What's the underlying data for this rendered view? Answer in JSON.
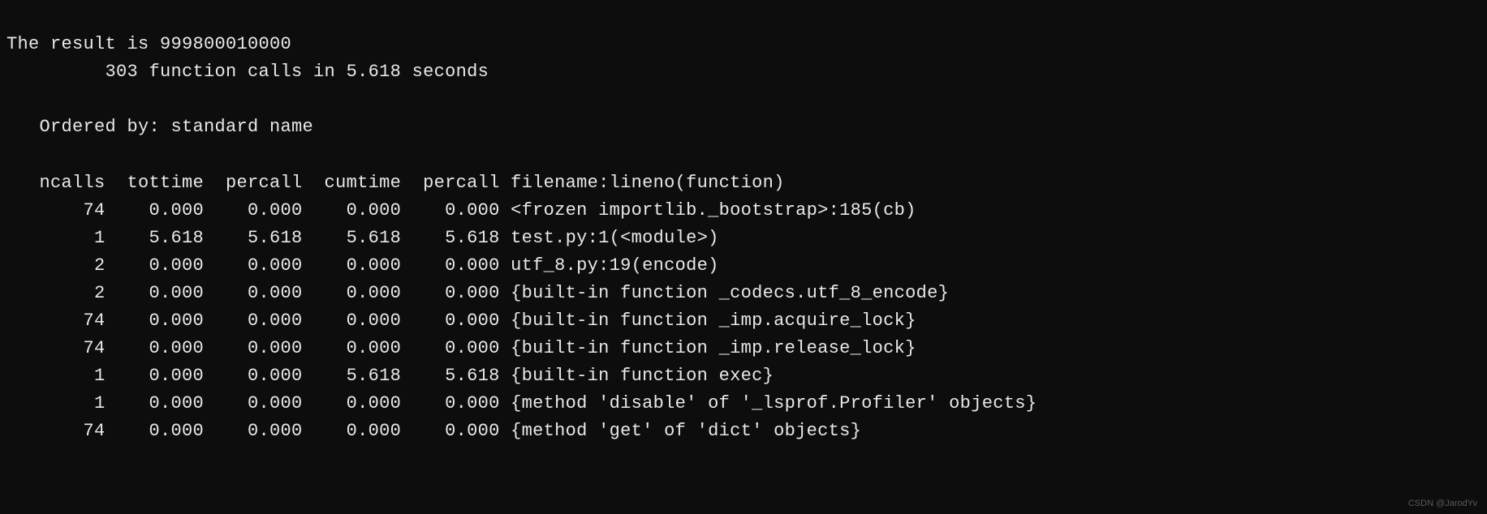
{
  "terminal": {
    "result_line": "The result is 999800010000",
    "summary_line": "         303 function calls in 5.618 seconds",
    "ordered_line": "   Ordered by: standard name",
    "header": {
      "ncalls": "ncalls",
      "tottime": "tottime",
      "percall1": "percall",
      "cumtime": "cumtime",
      "percall2": "percall",
      "fileline": "filename:lineno(function)"
    },
    "rows": [
      {
        "ncalls": "74",
        "tottime": "0.000",
        "percall1": "0.000",
        "cumtime": "0.000",
        "percall2": "0.000",
        "fileline": "<frozen importlib._bootstrap>:185(cb)"
      },
      {
        "ncalls": "1",
        "tottime": "5.618",
        "percall1": "5.618",
        "cumtime": "5.618",
        "percall2": "5.618",
        "fileline": "test.py:1(<module>)"
      },
      {
        "ncalls": "2",
        "tottime": "0.000",
        "percall1": "0.000",
        "cumtime": "0.000",
        "percall2": "0.000",
        "fileline": "utf_8.py:19(encode)"
      },
      {
        "ncalls": "2",
        "tottime": "0.000",
        "percall1": "0.000",
        "cumtime": "0.000",
        "percall2": "0.000",
        "fileline": "{built-in function _codecs.utf_8_encode}"
      },
      {
        "ncalls": "74",
        "tottime": "0.000",
        "percall1": "0.000",
        "cumtime": "0.000",
        "percall2": "0.000",
        "fileline": "{built-in function _imp.acquire_lock}"
      },
      {
        "ncalls": "74",
        "tottime": "0.000",
        "percall1": "0.000",
        "cumtime": "0.000",
        "percall2": "0.000",
        "fileline": "{built-in function _imp.release_lock}"
      },
      {
        "ncalls": "1",
        "tottime": "0.000",
        "percall1": "0.000",
        "cumtime": "5.618",
        "percall2": "5.618",
        "fileline": "{built-in function exec}"
      },
      {
        "ncalls": "1",
        "tottime": "0.000",
        "percall1": "0.000",
        "cumtime": "0.000",
        "percall2": "0.000",
        "fileline": "{method 'disable' of '_lsprof.Profiler' objects}"
      },
      {
        "ncalls": "74",
        "tottime": "0.000",
        "percall1": "0.000",
        "cumtime": "0.000",
        "percall2": "0.000",
        "fileline": "{method 'get' of 'dict' objects}"
      }
    ]
  },
  "watermark": "CSDN @JarodYv"
}
